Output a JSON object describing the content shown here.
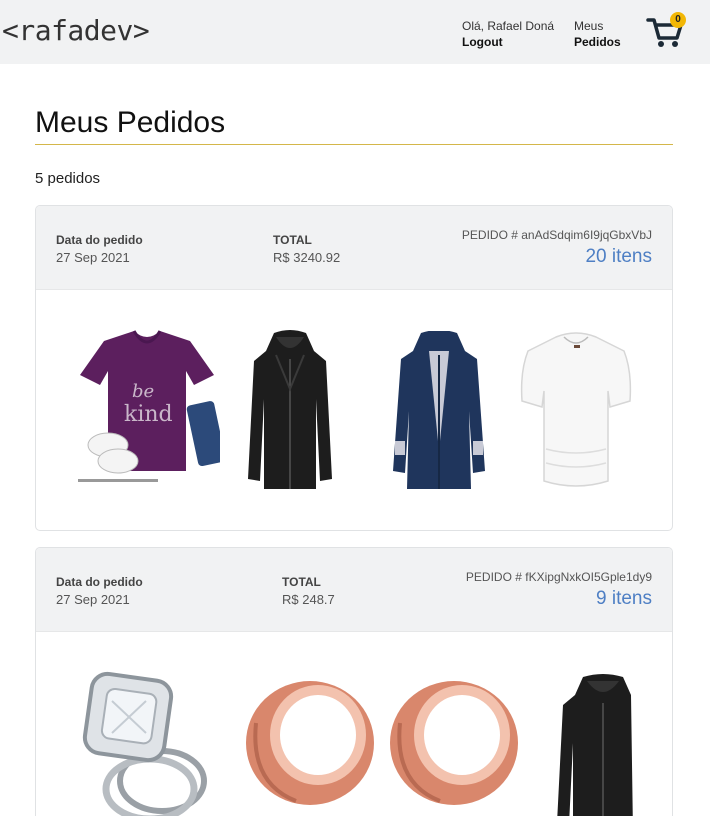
{
  "header": {
    "logo": "<rafadev>",
    "greeting": "Olá, Rafael Doná",
    "logout": "Logout",
    "orders_line1": "Meus",
    "orders_line2": "Pedidos",
    "cart_count": "0",
    "cart_icon": "cart-icon"
  },
  "page": {
    "title": "Meus Pedidos",
    "count": "5 pedidos"
  },
  "orders": [
    {
      "date_label": "Data do pedido",
      "date": "27 Sep 2021",
      "total_label": "TOTAL",
      "total": "R$ 3240.92",
      "order_id": "PEDIDO # anAdSdqim6I9jqGbxVbJ",
      "items": "20 itens",
      "thumbnails": [
        "purple-be-kind-tshirt",
        "black-leather-jacket",
        "navy-rain-jacket",
        "white-dolman-top"
      ]
    },
    {
      "date_label": "Data do pedido",
      "date": "27 Sep 2021",
      "total_label": "TOTAL",
      "total": "R$ 248.7",
      "order_id": "PEDIDO # fKXipgNxkOI5Gple1dy9",
      "items": "9 itens",
      "thumbnails": [
        "diamond-ring-set",
        "rose-gold-tunnel",
        "rose-gold-tunnel",
        "black-leather-jacket"
      ]
    }
  ],
  "colors": {
    "accent_link": "#4e7fc4",
    "header_bg": "#f1f2f3",
    "title_rule": "#d4b74a",
    "badge": "#f2b705"
  }
}
